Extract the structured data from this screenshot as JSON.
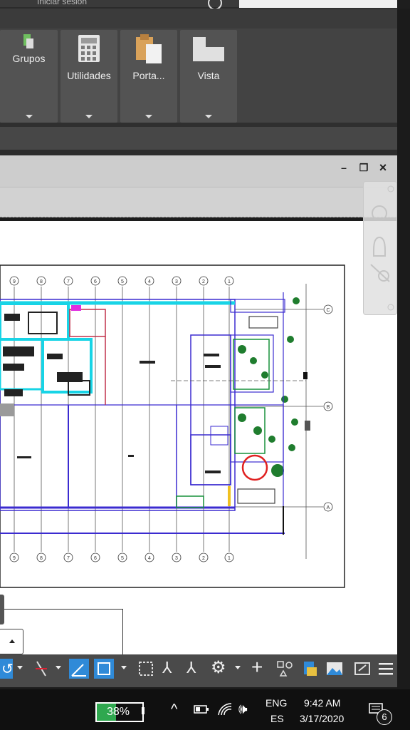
{
  "titlebar": {
    "signin_text": "Iniciar sesión"
  },
  "ribbon": {
    "buttons": [
      {
        "label": "Grupos"
      },
      {
        "label": "Utilidades"
      },
      {
        "label": "Porta..."
      },
      {
        "label": "Vista"
      }
    ]
  },
  "window_controls": {
    "minimize": "–",
    "restore": "❐",
    "close": "×"
  },
  "drawing": {
    "grid_column_labels": [
      "9",
      "8",
      "7",
      "6",
      "5",
      "4",
      "3",
      "2",
      "1"
    ],
    "grid_row_labels": [
      "C",
      "B",
      "A"
    ]
  },
  "taskbar": {
    "battery": "38%",
    "language": "ENG",
    "region": "ES",
    "time": "9:42 AM",
    "date": "3/17/2020",
    "notifications": "6"
  },
  "colors": {
    "accent": "#2f8ad8",
    "battery": "#2fa84f"
  }
}
